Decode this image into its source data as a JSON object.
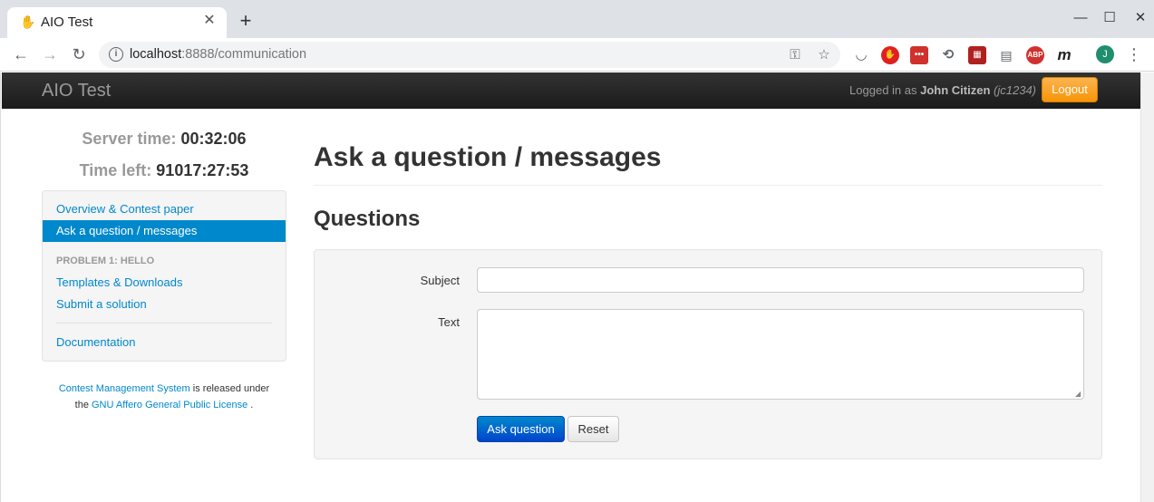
{
  "browser": {
    "tab_title": "AIO Test",
    "new_tab": "+",
    "url_host": "localhost",
    "url_path": ":8888/communication",
    "profile_initial": "J",
    "ext_abp": "ABP",
    "ext_m": "m"
  },
  "navbar": {
    "brand": "AIO Test",
    "logged_in_prefix": "Logged in as",
    "user_name": "John Citizen",
    "user_id": "(jc1234)",
    "logout": "Logout"
  },
  "status": {
    "server_time_label": "Server time:",
    "server_time_value": "00:32:06",
    "time_left_label": "Time left:",
    "time_left_value": "91017:27:53"
  },
  "sidebar": {
    "overview": "Overview & Contest paper",
    "ask": "Ask a question / messages",
    "problem_header": "PROBLEM 1: HELLO",
    "templates": "Templates & Downloads",
    "submit": "Submit a solution",
    "documentation": "Documentation"
  },
  "footer": {
    "cms_link": "Contest Management System",
    "released": "is released under",
    "the": "the",
    "license_link": "GNU Affero General Public License",
    "period": "."
  },
  "main": {
    "title": "Ask a question / messages",
    "section": "Questions",
    "subject_label": "Subject",
    "text_label": "Text",
    "subject_value": "",
    "text_value": "",
    "ask_button": "Ask question",
    "reset_button": "Reset"
  },
  "colors": {
    "link": "#0088cc",
    "navbar": "#222222",
    "logout": "#f89406",
    "primary": "#0066cc"
  }
}
